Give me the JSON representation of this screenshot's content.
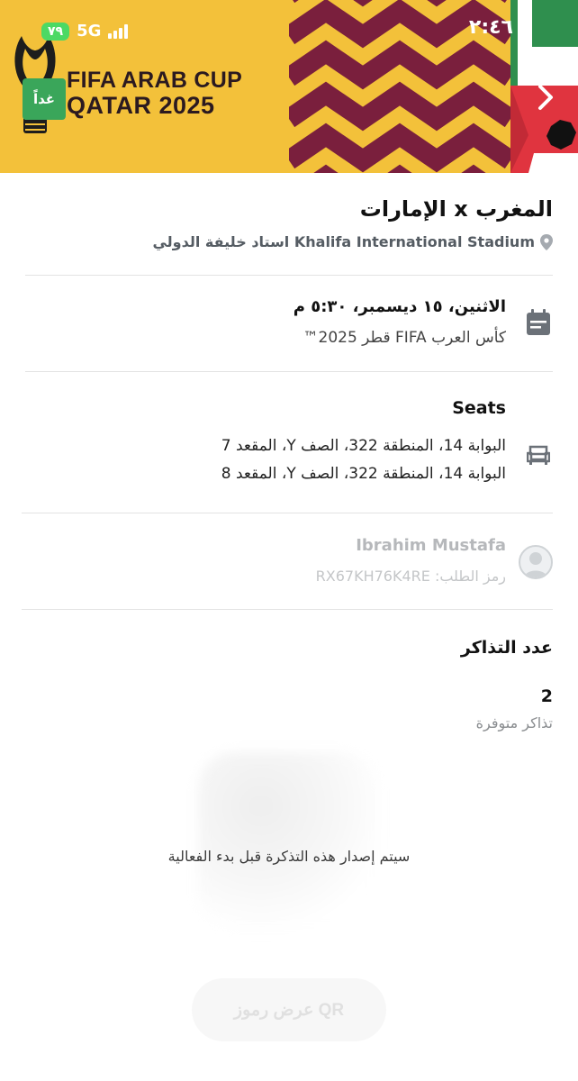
{
  "status_bar": {
    "time": "٢:٤٦",
    "battery": "٧٩",
    "network": "5G"
  },
  "banner": {
    "line1": "FIFA ARAB CUP",
    "line2": "QATAR 2025",
    "badge": "غداً",
    "colors": {
      "yellow": "#f3c13a",
      "maroon": "#7a1f3d",
      "green": "#3aa65a",
      "red": "#e0343f"
    }
  },
  "match": {
    "title": "المغرب x الإمارات",
    "venue": "استاد خليفة الدولي  Khalifa International Stadium",
    "venue_icon": "location-pin-icon"
  },
  "event": {
    "datetime": "الاثنين، ١٥ ديسمبر، ٥:٣٠ م",
    "competition": "كأس العرب FIFA قطر 2025™",
    "icon": "calendar-icon"
  },
  "seats": {
    "heading": "Seats",
    "lines": [
      "البوابة 14، المنطقة 322، الصف Y، المقعد 7",
      "البوابة 14، المنطقة 322، الصف Y، المقعد 8"
    ],
    "icon": "seat-icon"
  },
  "holder": {
    "name": "Ibrahim Mustafa",
    "code_label": "رمز الطلب: RX67KH76K4RE"
  },
  "tickets": {
    "heading": "عدد التذاكر",
    "count": "2",
    "available_label": "تذاكر متوفرة"
  },
  "qr": {
    "note": "سيتم إصدار هذه التذكرة قبل بدء الفعالية",
    "button": "عرض رموز QR"
  }
}
